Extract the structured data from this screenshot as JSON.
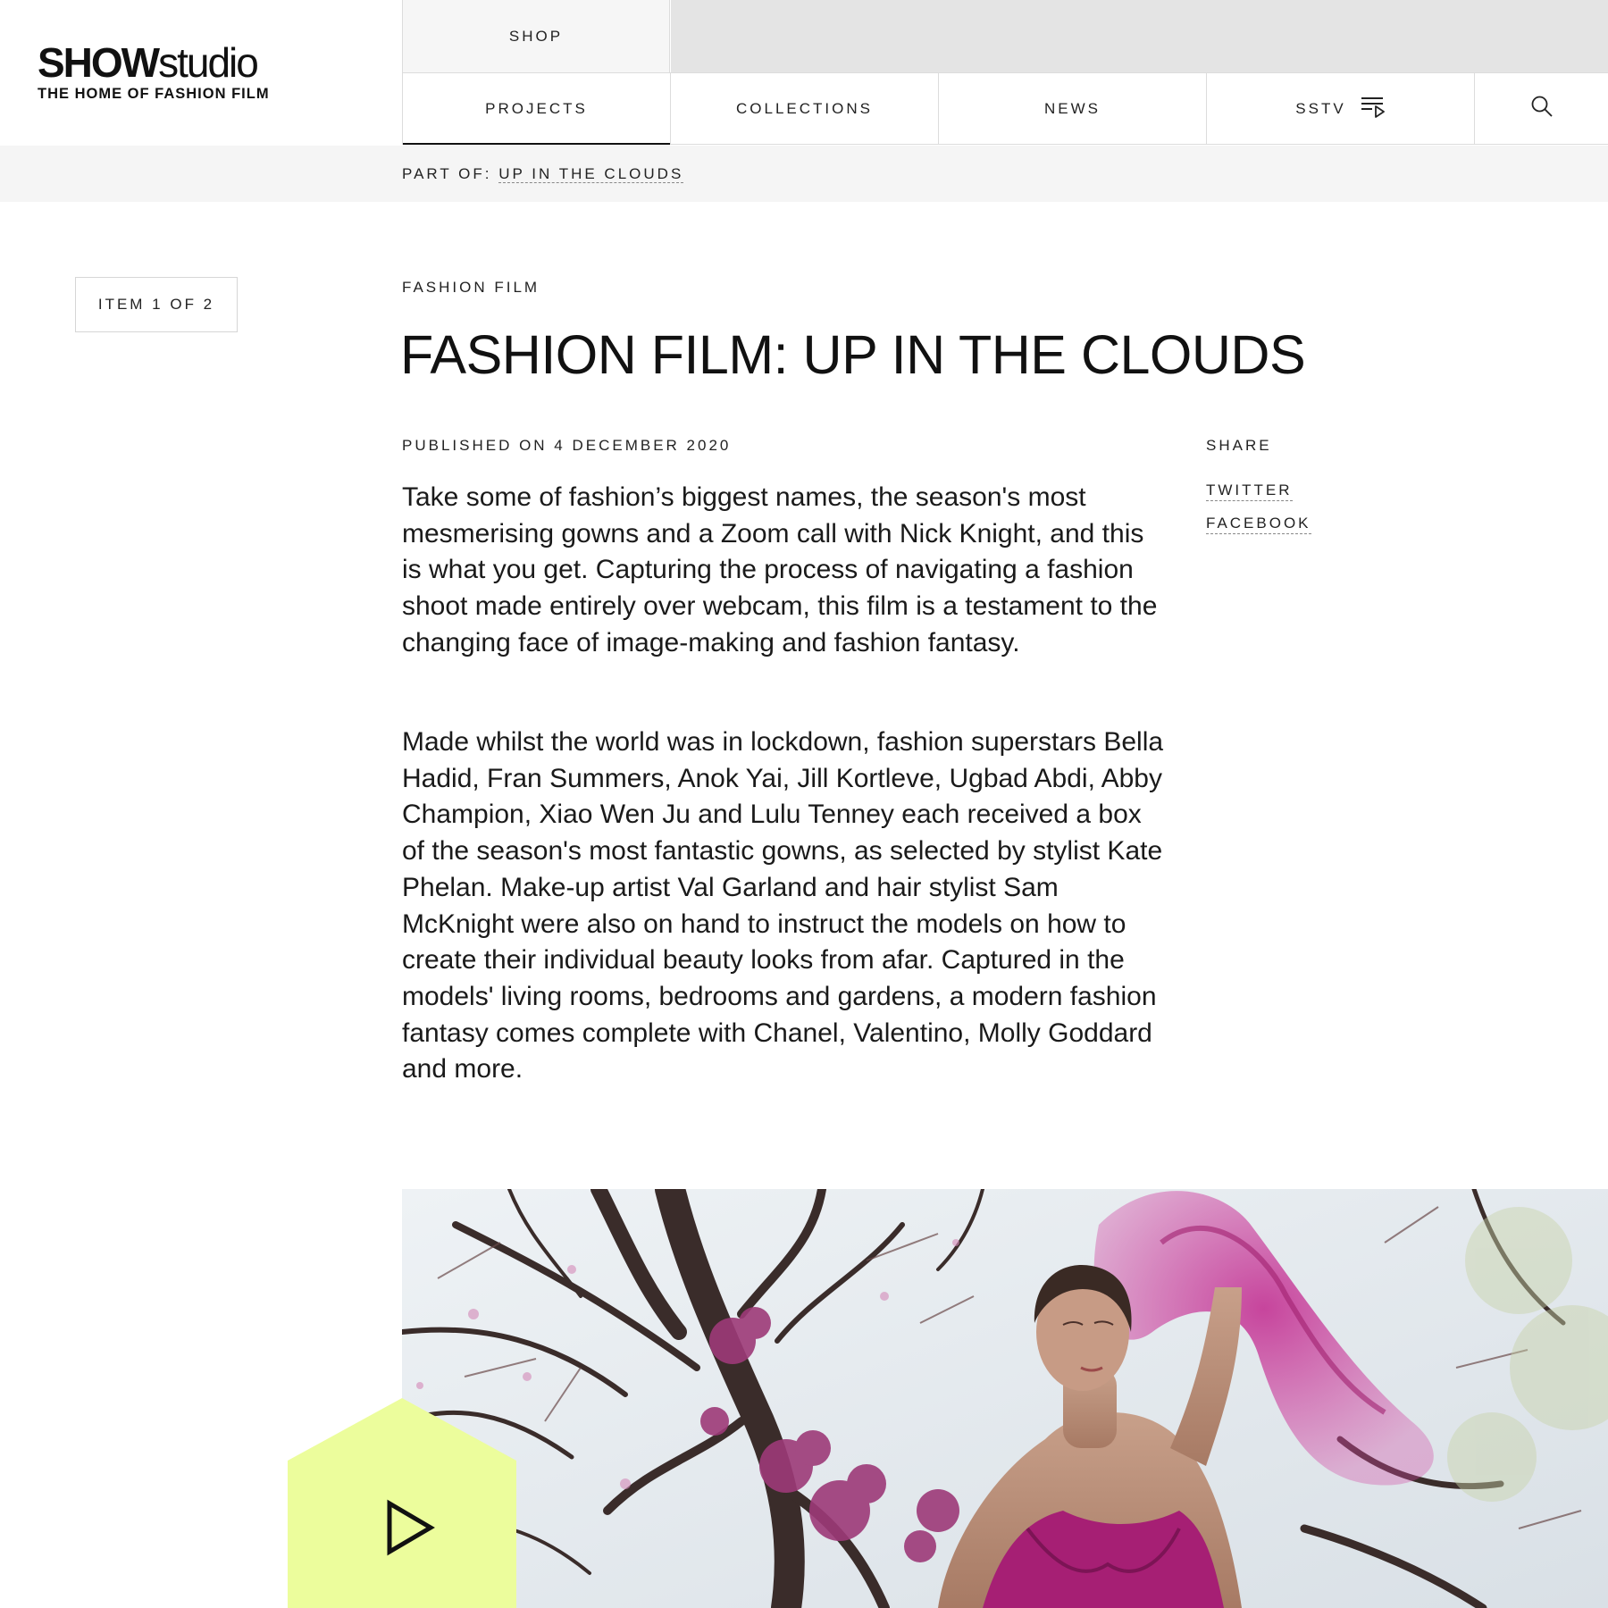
{
  "logo": {
    "main_bold": "SHOW",
    "main_light": "studio",
    "tagline": "THE HOME OF FASHION FILM"
  },
  "nav": {
    "shop": "SHOP",
    "items": [
      {
        "label": "PROJECTS"
      },
      {
        "label": "COLLECTIONS"
      },
      {
        "label": "NEWS"
      },
      {
        "label": "SSTV"
      }
    ]
  },
  "breadcrumb": {
    "prefix": "PART OF:",
    "link": "UP IN THE CLOUDS"
  },
  "item_counter": "ITEM 1 OF 2",
  "article": {
    "category": "FASHION FILM",
    "title": "FASHION FILM: UP IN THE CLOUDS",
    "published": "PUBLISHED ON 4 DECEMBER 2020",
    "paragraph1": "Take some of fashion’s biggest names, the season's most mesmerising gowns and a Zoom call with Nick Knight, and this is what you get. Capturing the process of navigating a fashion shoot made entirely over webcam, this film is a testament to the changing face of image-making and fashion fantasy.",
    "paragraph2": "Made whilst the world was in lockdown, fashion superstars Bella Hadid, Fran Summers, Anok Yai, Jill Kortleve, Ugbad Abdi, Abby Champion, Xiao Wen Ju and Lulu Tenney each received a box of the season's most fantastic gowns, as selected by stylist Kate Phelan. Make-up artist Val Garland and hair stylist Sam McKnight were also on hand to instruct the models on how to create their individual beauty looks from afar. Captured in the models' living rooms, bedrooms and gardens, a modern fashion fantasy comes complete with Chanel, Valentino, Molly Goddard and more."
  },
  "share": {
    "label": "SHARE",
    "twitter": "TWITTER",
    "facebook": "FACEBOOK"
  },
  "colors": {
    "play_badge": "#ecfd9c",
    "accent_magenta": "#b0267f",
    "header_grey": "#e4e4e4"
  },
  "icons": {
    "search": "search-icon",
    "playlist": "playlist-play-icon",
    "play": "play-icon"
  }
}
